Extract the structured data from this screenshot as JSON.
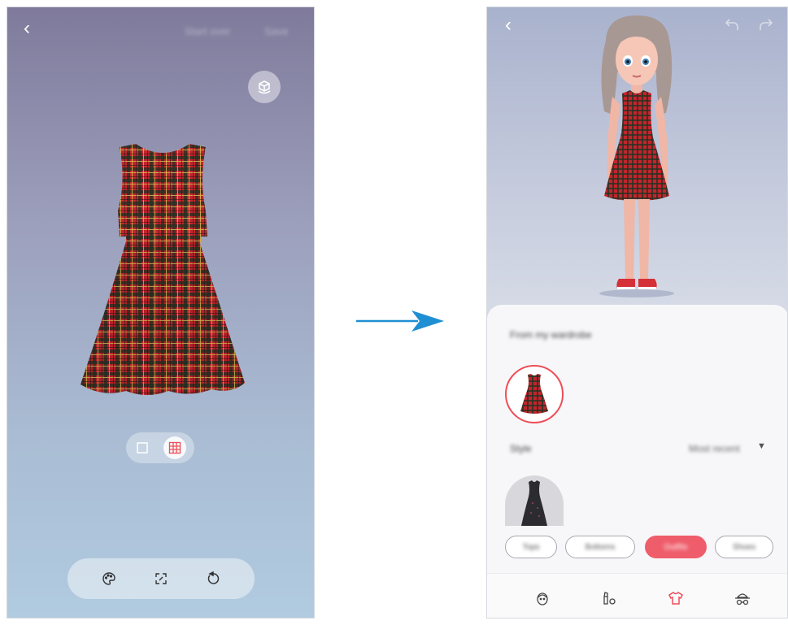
{
  "left_screen": {
    "header": {
      "back_icon": "chevron-left-icon",
      "secondary_action": "Start over",
      "primary_action": "Save"
    },
    "rotate_icon": "cube-rotate-icon",
    "preview_item": "plaid-dress",
    "pattern_toggle": {
      "options": [
        "single-square-icon",
        "grid-pattern-icon"
      ],
      "selected": "grid-pattern-icon"
    },
    "bottom_tools": [
      "palette-icon",
      "resize-icon",
      "reset-icon"
    ]
  },
  "right_screen": {
    "header": {
      "back_icon": "chevron-left-icon",
      "undo_icon": "undo-icon",
      "redo_icon": "redo-icon"
    },
    "panel": {
      "title": "From my wardrobe",
      "style_label": "Style",
      "style_value": "Most recent",
      "categories": [
        {
          "label": "Tops",
          "active": false
        },
        {
          "label": "Bottoms",
          "active": false
        },
        {
          "label": "Outfits",
          "active": true
        },
        {
          "label": "Shoes",
          "active": false
        }
      ]
    },
    "tabs": [
      "face-icon",
      "makeup-icon",
      "clothing-icon",
      "accessories-icon"
    ],
    "active_tab": "clothing-icon"
  },
  "colors": {
    "accent": "#ef4d57",
    "arrow": "#1f8fd4",
    "plaid_red": "#c8252d",
    "plaid_dark": "#1f3a26"
  }
}
